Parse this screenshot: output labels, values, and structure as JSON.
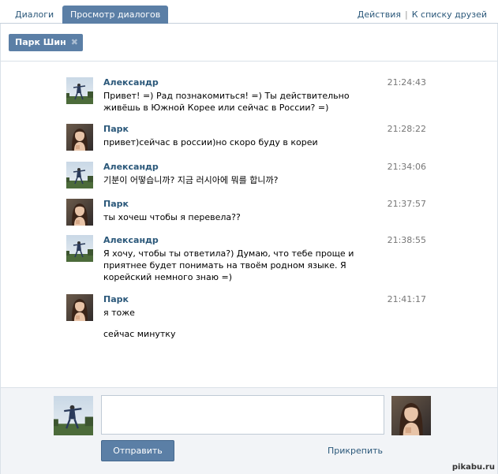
{
  "tabs": {
    "dialogs": "Диалоги",
    "view": "Просмотр диалогов"
  },
  "top_links": {
    "actions": "Действия",
    "separator": "|",
    "friends": "К списку друзей"
  },
  "chip": {
    "label": "Парк Шин",
    "close_icon": "close-icon"
  },
  "messages": [
    {
      "author": "Александр",
      "time": "21:24:43",
      "text": "Привет! =) Рад познакомиться! =) Ты действительно живёшь в Южной Корее или сейчас в России? =)",
      "avatar": "man-avatar"
    },
    {
      "author": "Парк",
      "time": "21:28:22",
      "text": "привет)сейчас в россии)но скоро буду в кореи",
      "avatar": "woman-avatar"
    },
    {
      "author": "Александр",
      "time": "21:34:06",
      "text": "기분이 어떻습니까? 지금 러시아에 뭐를 합니까?",
      "avatar": "man-avatar"
    },
    {
      "author": "Парк",
      "time": "21:37:57",
      "text": "ты хочеш чтобы я перевела??",
      "avatar": "woman-avatar"
    },
    {
      "author": "Александр",
      "time": "21:38:55",
      "text": "Я хочу, чтобы ты ответила?) Думаю, что тебе проще и приятнее будет понимать на твоём родном языке. Я корейский немного знаю =)",
      "avatar": "man-avatar"
    },
    {
      "author": "Парк",
      "time": "21:41:17",
      "text": "я тоже",
      "text2": "сейчас минутку",
      "avatar": "woman-avatar"
    }
  ],
  "compose": {
    "message_value": "",
    "send_label": "Отправить",
    "attach_label": "Прикрепить"
  },
  "watermark": "pikabu.ru",
  "colors": {
    "accent": "#5b7fa6",
    "link": "#2b587a",
    "compose_bg": "#f2f4f7"
  }
}
